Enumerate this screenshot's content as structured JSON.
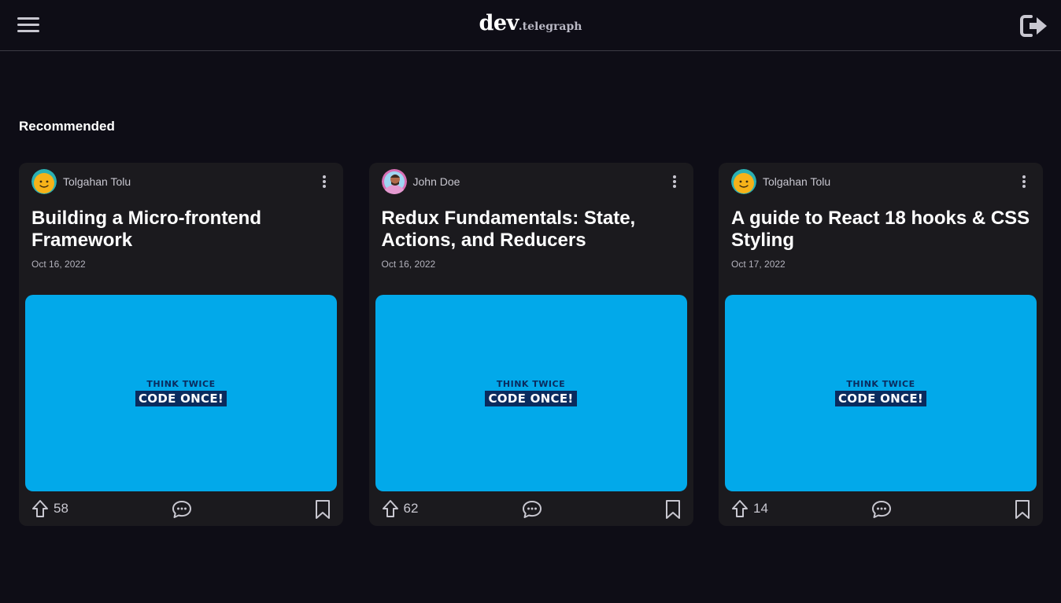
{
  "header": {
    "logo_main": "dev",
    "logo_sub": ".telegraph",
    "menu_icon": "hamburger-menu-icon",
    "logout_icon": "sign-out-icon"
  },
  "section": {
    "title": "Recommended"
  },
  "cards": [
    {
      "author": "Tolgahan Tolu",
      "avatar": "smiley-avatar",
      "title": "Building a Micro-frontend Framework",
      "date": "Oct 16, 2022",
      "cover_top": "THINK TWICE",
      "cover_bottom": "CODE ONCE!",
      "upvotes": "58"
    },
    {
      "author": "John Doe",
      "avatar": "person-avatar",
      "title": "Redux Fundamentals: State, Actions, and Reducers",
      "date": "Oct 16, 2022",
      "cover_top": "THINK TWICE",
      "cover_bottom": "CODE ONCE!",
      "upvotes": "62"
    },
    {
      "author": "Tolgahan Tolu",
      "avatar": "smiley-avatar",
      "title": "A guide to React 18 hooks & CSS Styling",
      "date": "Oct 17, 2022",
      "cover_top": "THINK TWICE",
      "cover_bottom": "CODE ONCE!",
      "upvotes": "14"
    }
  ],
  "colors": {
    "background": "#0e0d16",
    "card": "#1b1a1e",
    "cover": "#02a9ea",
    "cover_text": "#0a2b5e"
  }
}
